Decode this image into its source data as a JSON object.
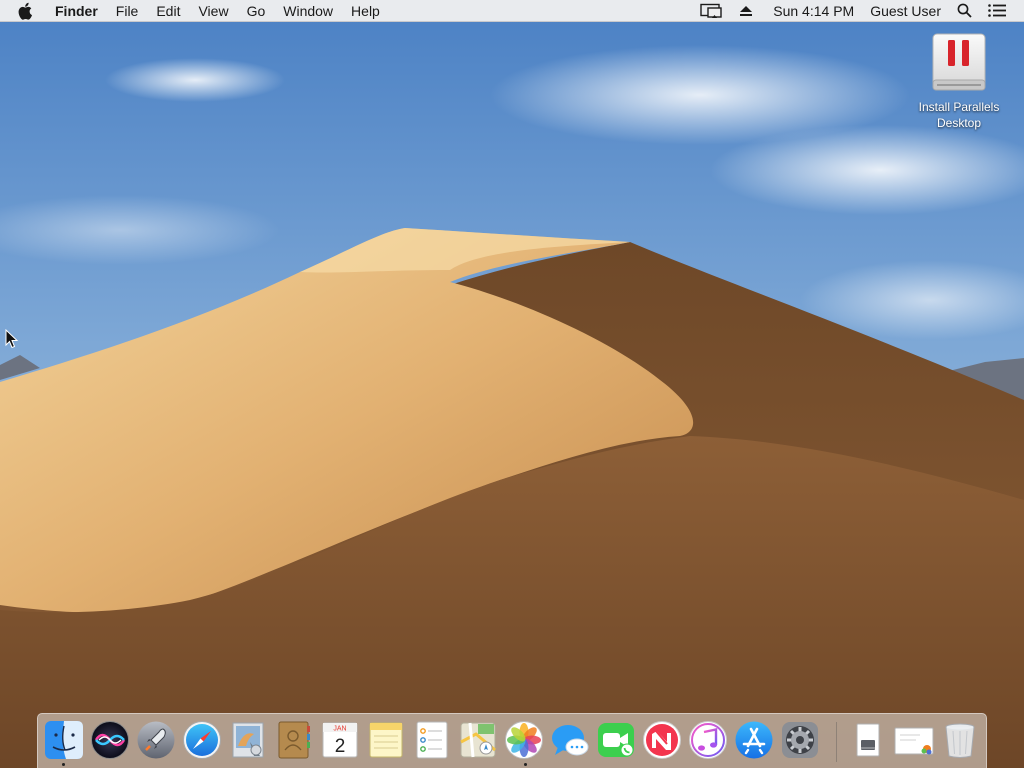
{
  "menubar": {
    "app_name": "Finder",
    "menus": [
      "File",
      "Edit",
      "View",
      "Go",
      "Window",
      "Help"
    ],
    "clock": "Sun 4:14 PM",
    "user": "Guest User"
  },
  "desktop": {
    "icons": [
      {
        "label": "Install Parallels Desktop",
        "label_line1": "Install Parallels",
        "label_line2": "Desktop",
        "icon": "parallels-installer-drive-icon"
      }
    ],
    "wallpaper": "macos-mojave-dunes"
  },
  "dock": {
    "items": [
      {
        "name": "Finder",
        "icon": "finder-icon",
        "running": true
      },
      {
        "name": "Siri",
        "icon": "siri-icon",
        "running": false
      },
      {
        "name": "Launchpad",
        "icon": "launchpad-icon",
        "running": false
      },
      {
        "name": "Safari",
        "icon": "safari-icon",
        "running": false
      },
      {
        "name": "Mail",
        "icon": "mail-icon",
        "running": false
      },
      {
        "name": "Contacts",
        "icon": "contacts-icon",
        "running": false
      },
      {
        "name": "Calendar",
        "icon": "calendar-icon",
        "running": false,
        "month": "JAN",
        "day": "2"
      },
      {
        "name": "Notes",
        "icon": "notes-icon",
        "running": false
      },
      {
        "name": "Reminders",
        "icon": "reminders-icon",
        "running": false
      },
      {
        "name": "Maps",
        "icon": "maps-icon",
        "running": false
      },
      {
        "name": "Photos",
        "icon": "photos-icon",
        "running": true
      },
      {
        "name": "Messages",
        "icon": "messages-icon",
        "running": false
      },
      {
        "name": "FaceTime",
        "icon": "facetime-icon",
        "running": false
      },
      {
        "name": "News",
        "icon": "news-icon",
        "running": false
      },
      {
        "name": "iTunes",
        "icon": "itunes-icon",
        "running": false
      },
      {
        "name": "App Store",
        "icon": "app-store-icon",
        "running": false
      },
      {
        "name": "System Preferences",
        "icon": "system-preferences-icon",
        "running": false
      }
    ],
    "right_items": [
      {
        "name": "Downloads",
        "icon": "downloads-stack-icon"
      },
      {
        "name": "Documents",
        "icon": "documents-stack-icon"
      },
      {
        "name": "Trash",
        "icon": "trash-icon"
      }
    ]
  },
  "colors": {
    "sky_top": "#4f86c9",
    "sky_bottom": "#a9c6e3",
    "dune_light": "#e3b87c",
    "dune_shadow": "#7c5432",
    "parallels_red": "#d8242b"
  }
}
